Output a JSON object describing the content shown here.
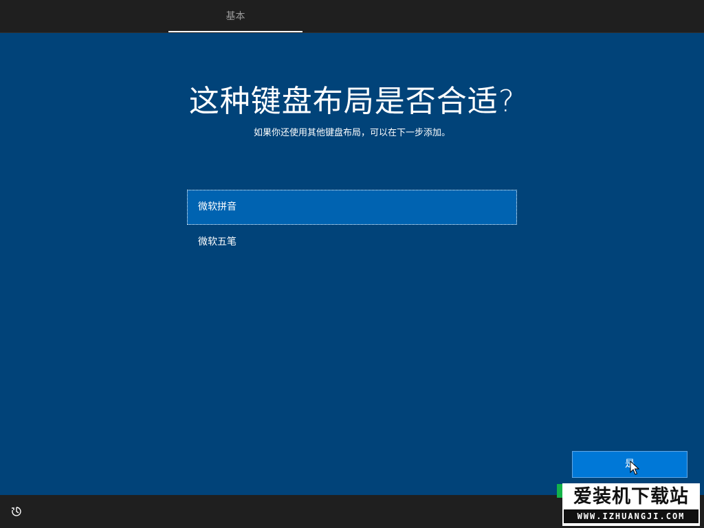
{
  "header": {
    "tab_label": "基本"
  },
  "main": {
    "title": "这种键盘布局是否合适?",
    "subtitle": "如果你还使用其他键盘布局，可以在下一步添加。",
    "layouts": [
      {
        "label": "微软拼音",
        "selected": true
      },
      {
        "label": "微软五笔",
        "selected": false
      }
    ]
  },
  "footer": {
    "next_label": "是",
    "ease_of_access_icon": "ease-of-access-icon"
  },
  "watermark": {
    "title": "爱装机下载站",
    "url": "WWW.IZHUANGJI.COM"
  },
  "colors": {
    "background": "#014379",
    "selected_item": "#0063b1",
    "button": "#0078d7",
    "bar": "#1f1f1f"
  }
}
